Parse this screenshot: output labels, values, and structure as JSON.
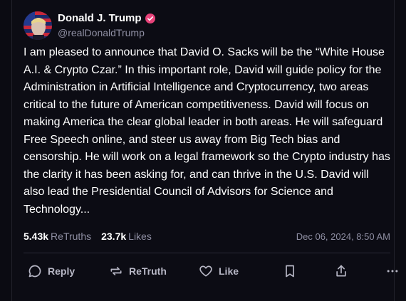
{
  "post": {
    "author": {
      "display_name": "Donald J. Trump",
      "handle": "@realDonaldTrump",
      "verified": true,
      "verified_color": "#e8437a"
    },
    "text": "I am pleased to announce that David O. Sacks will be the “White House A.I. & Crypto Czar.” In this important role, David will guide policy for the Administration in Artificial Intelligence and Cryptocurrency, two areas critical to the future of American competitiveness. David will focus on making America the clear global leader in both areas. He will safeguard Free Speech online, and steer us away from Big Tech bias and censorship. He will work on a legal framework so the Crypto industry has the clarity it has been asking for, and can thrive in the U.S. David will also lead the Presidential Council of Advisors for Science and Technology...",
    "stats": {
      "retruths_count": "5.43k",
      "retruths_label": "ReTruths",
      "likes_count": "23.7k",
      "likes_label": "Likes"
    },
    "timestamp": "Dec 06, 2024, 8:50 AM"
  },
  "actions": {
    "reply_label": "Reply",
    "retruth_label": "ReTruth",
    "like_label": "Like"
  },
  "colors": {
    "background": "#0c0c14",
    "text": "#ffffff",
    "muted": "#8f8fa3",
    "icon": "#b8b8c6"
  }
}
